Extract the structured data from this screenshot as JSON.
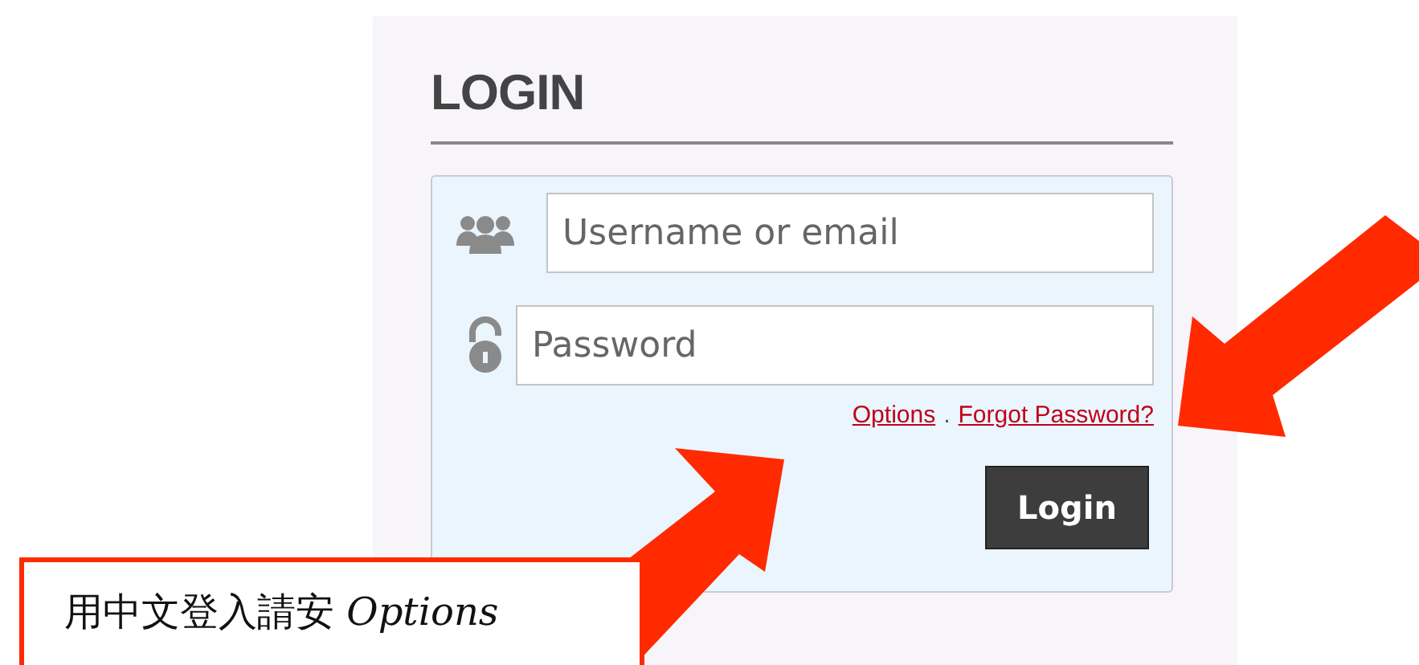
{
  "login": {
    "title": "LOGIN",
    "fields": [
      {
        "kind": "user",
        "placeholder": "Username or email"
      },
      {
        "kind": "lock",
        "placeholder": "Password"
      }
    ],
    "links": [
      "Options",
      "Forgot Password?"
    ],
    "link_separator": ".",
    "button": "Login"
  },
  "annotation": {
    "text": "用中文登入請安 *Options*"
  }
}
